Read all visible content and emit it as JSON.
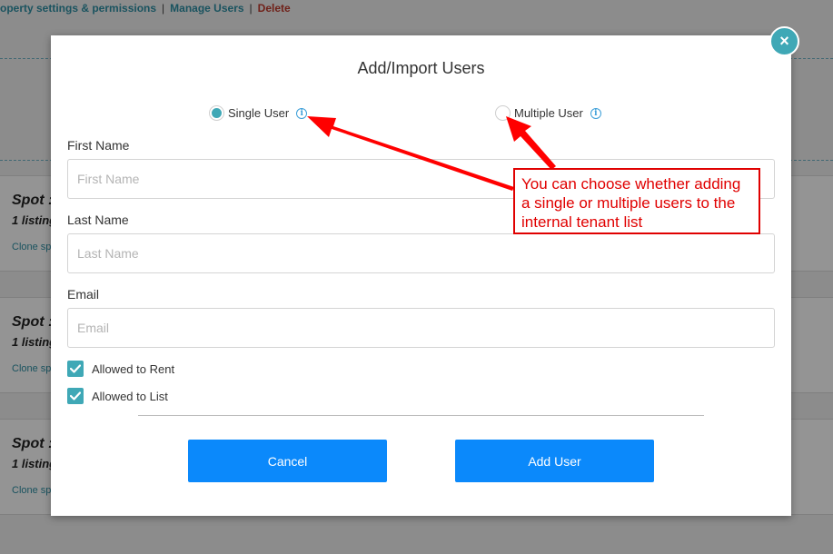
{
  "background": {
    "links": {
      "settings": "operty settings & permissions",
      "sep": "|",
      "manage": "Manage Users",
      "delete": "Delete"
    },
    "cards": [
      {
        "title": "Spot :",
        "subtitle": "1 listing",
        "clone": "Clone sp"
      },
      {
        "title": "Spot :",
        "subtitle": "1 listing",
        "clone": "Clone sp"
      },
      {
        "title": "Spot :",
        "subtitle": "1 listing",
        "clone": "Clone sp"
      }
    ]
  },
  "modal": {
    "close_label": "×",
    "title": "Add/Import Users",
    "mode_options": [
      {
        "label": "Single User",
        "selected": true
      },
      {
        "label": "Multiple User",
        "selected": false
      }
    ],
    "info_icon": "i",
    "fields": {
      "first_name": {
        "label": "First Name",
        "placeholder": "First Name",
        "value": ""
      },
      "last_name": {
        "label": "Last Name",
        "placeholder": "Last Name",
        "value": ""
      },
      "email": {
        "label": "Email",
        "placeholder": "Email",
        "value": ""
      }
    },
    "checkboxes": [
      {
        "label": "Allowed to Rent",
        "checked": true
      },
      {
        "label": "Allowed to List",
        "checked": true
      }
    ],
    "buttons": {
      "cancel": "Cancel",
      "add": "Add User"
    }
  },
  "annotation": {
    "text": "You can choose whether adding a single or multiple users to the internal tenant list"
  },
  "colors": {
    "accent": "#3fa8b6",
    "button": "#0b89fb",
    "annotation": "#e00000",
    "link": "#2d8fa4",
    "delete": "#c0392b"
  },
  "icons": {
    "close": "close-icon",
    "info": "info-icon",
    "check": "checkmark-icon",
    "arrow": "annotation-arrow"
  }
}
